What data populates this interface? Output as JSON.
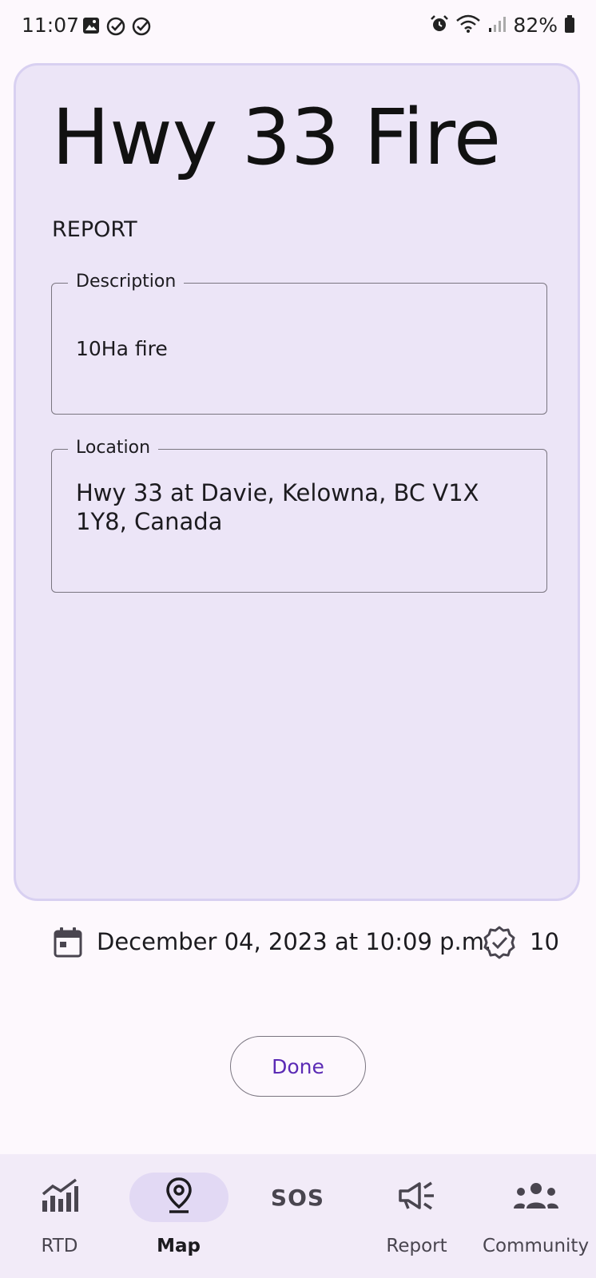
{
  "status_bar": {
    "time": "11:07",
    "battery": "82%",
    "left_icons": [
      "image-icon",
      "check-circle-icon",
      "check-circle-icon"
    ],
    "right_icons": [
      "alarm-icon",
      "wifi-icon",
      "signal-icon",
      "battery-icon"
    ]
  },
  "card": {
    "title": "Hwy 33 Fire",
    "section_label": "REPORT",
    "description": {
      "label": "Description",
      "value": "10Ha fire"
    },
    "location": {
      "label": "Location",
      "value": "Hwy 33 at Davie, Kelowna, BC V1X 1Y8, Canada"
    }
  },
  "meta": {
    "date": "December 04, 2023 at 10:09 p.m.",
    "verified_count": "10"
  },
  "done_button": "Done",
  "colors": {
    "card_bg": "#ece5f7",
    "card_border": "#d8d0f1",
    "accent": "#5b2bb5",
    "nav_bg": "#f2ebf8",
    "nav_active_pill": "#e2d9f4"
  },
  "nav": {
    "items": [
      {
        "label": "RTD",
        "icon": "chart-icon"
      },
      {
        "label": "Map",
        "icon": "map-pin-icon",
        "active": true
      },
      {
        "label": "",
        "icon": "sos-icon",
        "icon_text": "SOS"
      },
      {
        "label": "Report",
        "icon": "megaphone-icon"
      },
      {
        "label": "Community",
        "icon": "group-icon"
      }
    ]
  }
}
